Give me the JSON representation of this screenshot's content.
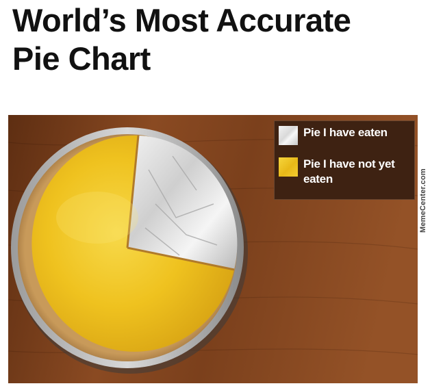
{
  "title": {
    "line1": "World’s Most Accurate",
    "line2": "Pie Chart"
  },
  "legend": {
    "items": [
      {
        "label": "Pie I have eaten",
        "color": "#e6e6e6"
      },
      {
        "label": "Pie I have not yet eaten",
        "color": "#f2c62a"
      }
    ]
  },
  "watermark": "MemeCenter.com",
  "colors": {
    "table_wood": "#7a3f1c",
    "pie_filling": "#f2c62a",
    "pie_tin": "#e6e6e6",
    "legend_bg": "#3e2212"
  },
  "pie": {
    "eaten_fraction": 0.22,
    "not_eaten_fraction": 0.78
  }
}
